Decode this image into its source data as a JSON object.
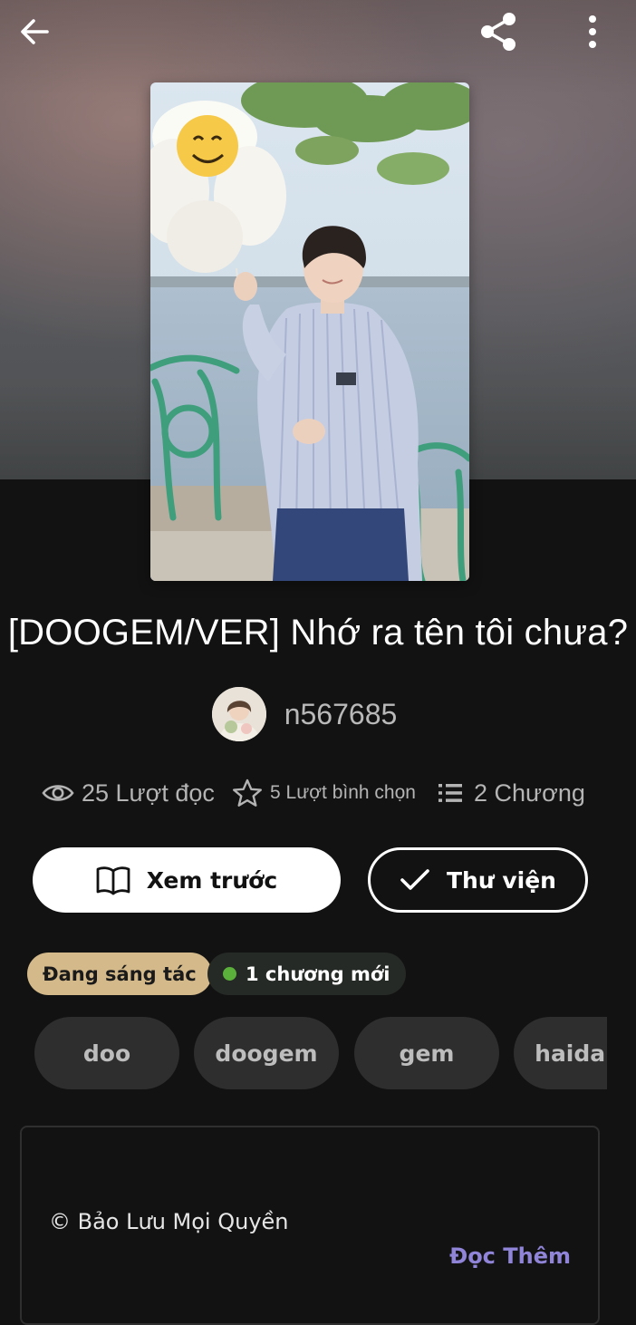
{
  "story": {
    "title": "[DOOGEM/VER] Nhớ ra tên tôi chưa?",
    "author": "n567685"
  },
  "stats": {
    "reads": "25 Lượt đọc",
    "votes": "5 Lượt bình chọn",
    "chapters": "2 Chương"
  },
  "actions": {
    "preview_label": "Xem trước",
    "library_label": "Thư viện"
  },
  "badges": {
    "status": "Đang sáng tác",
    "new_chapters": "1 chương mới"
  },
  "tags": [
    "doo",
    "doogem",
    "gem",
    "haidang"
  ],
  "description": {
    "text": "© Bảo Lưu Mọi Quyền",
    "read_more": "Đọc Thêm"
  },
  "icons": {
    "back": "arrow-left-icon",
    "share": "share-icon",
    "more": "more-vertical-icon",
    "reads": "eye-icon",
    "votes": "star-outline-icon",
    "chapters": "list-icon",
    "preview": "open-book-icon",
    "library": "checkmark-icon"
  },
  "colors": {
    "background": "#121212",
    "status_badge": "#d4b98a",
    "new_badge_dot": "#5bb03b",
    "read_more": "#8f84d8",
    "tag_bg": "#2e2e2e"
  }
}
